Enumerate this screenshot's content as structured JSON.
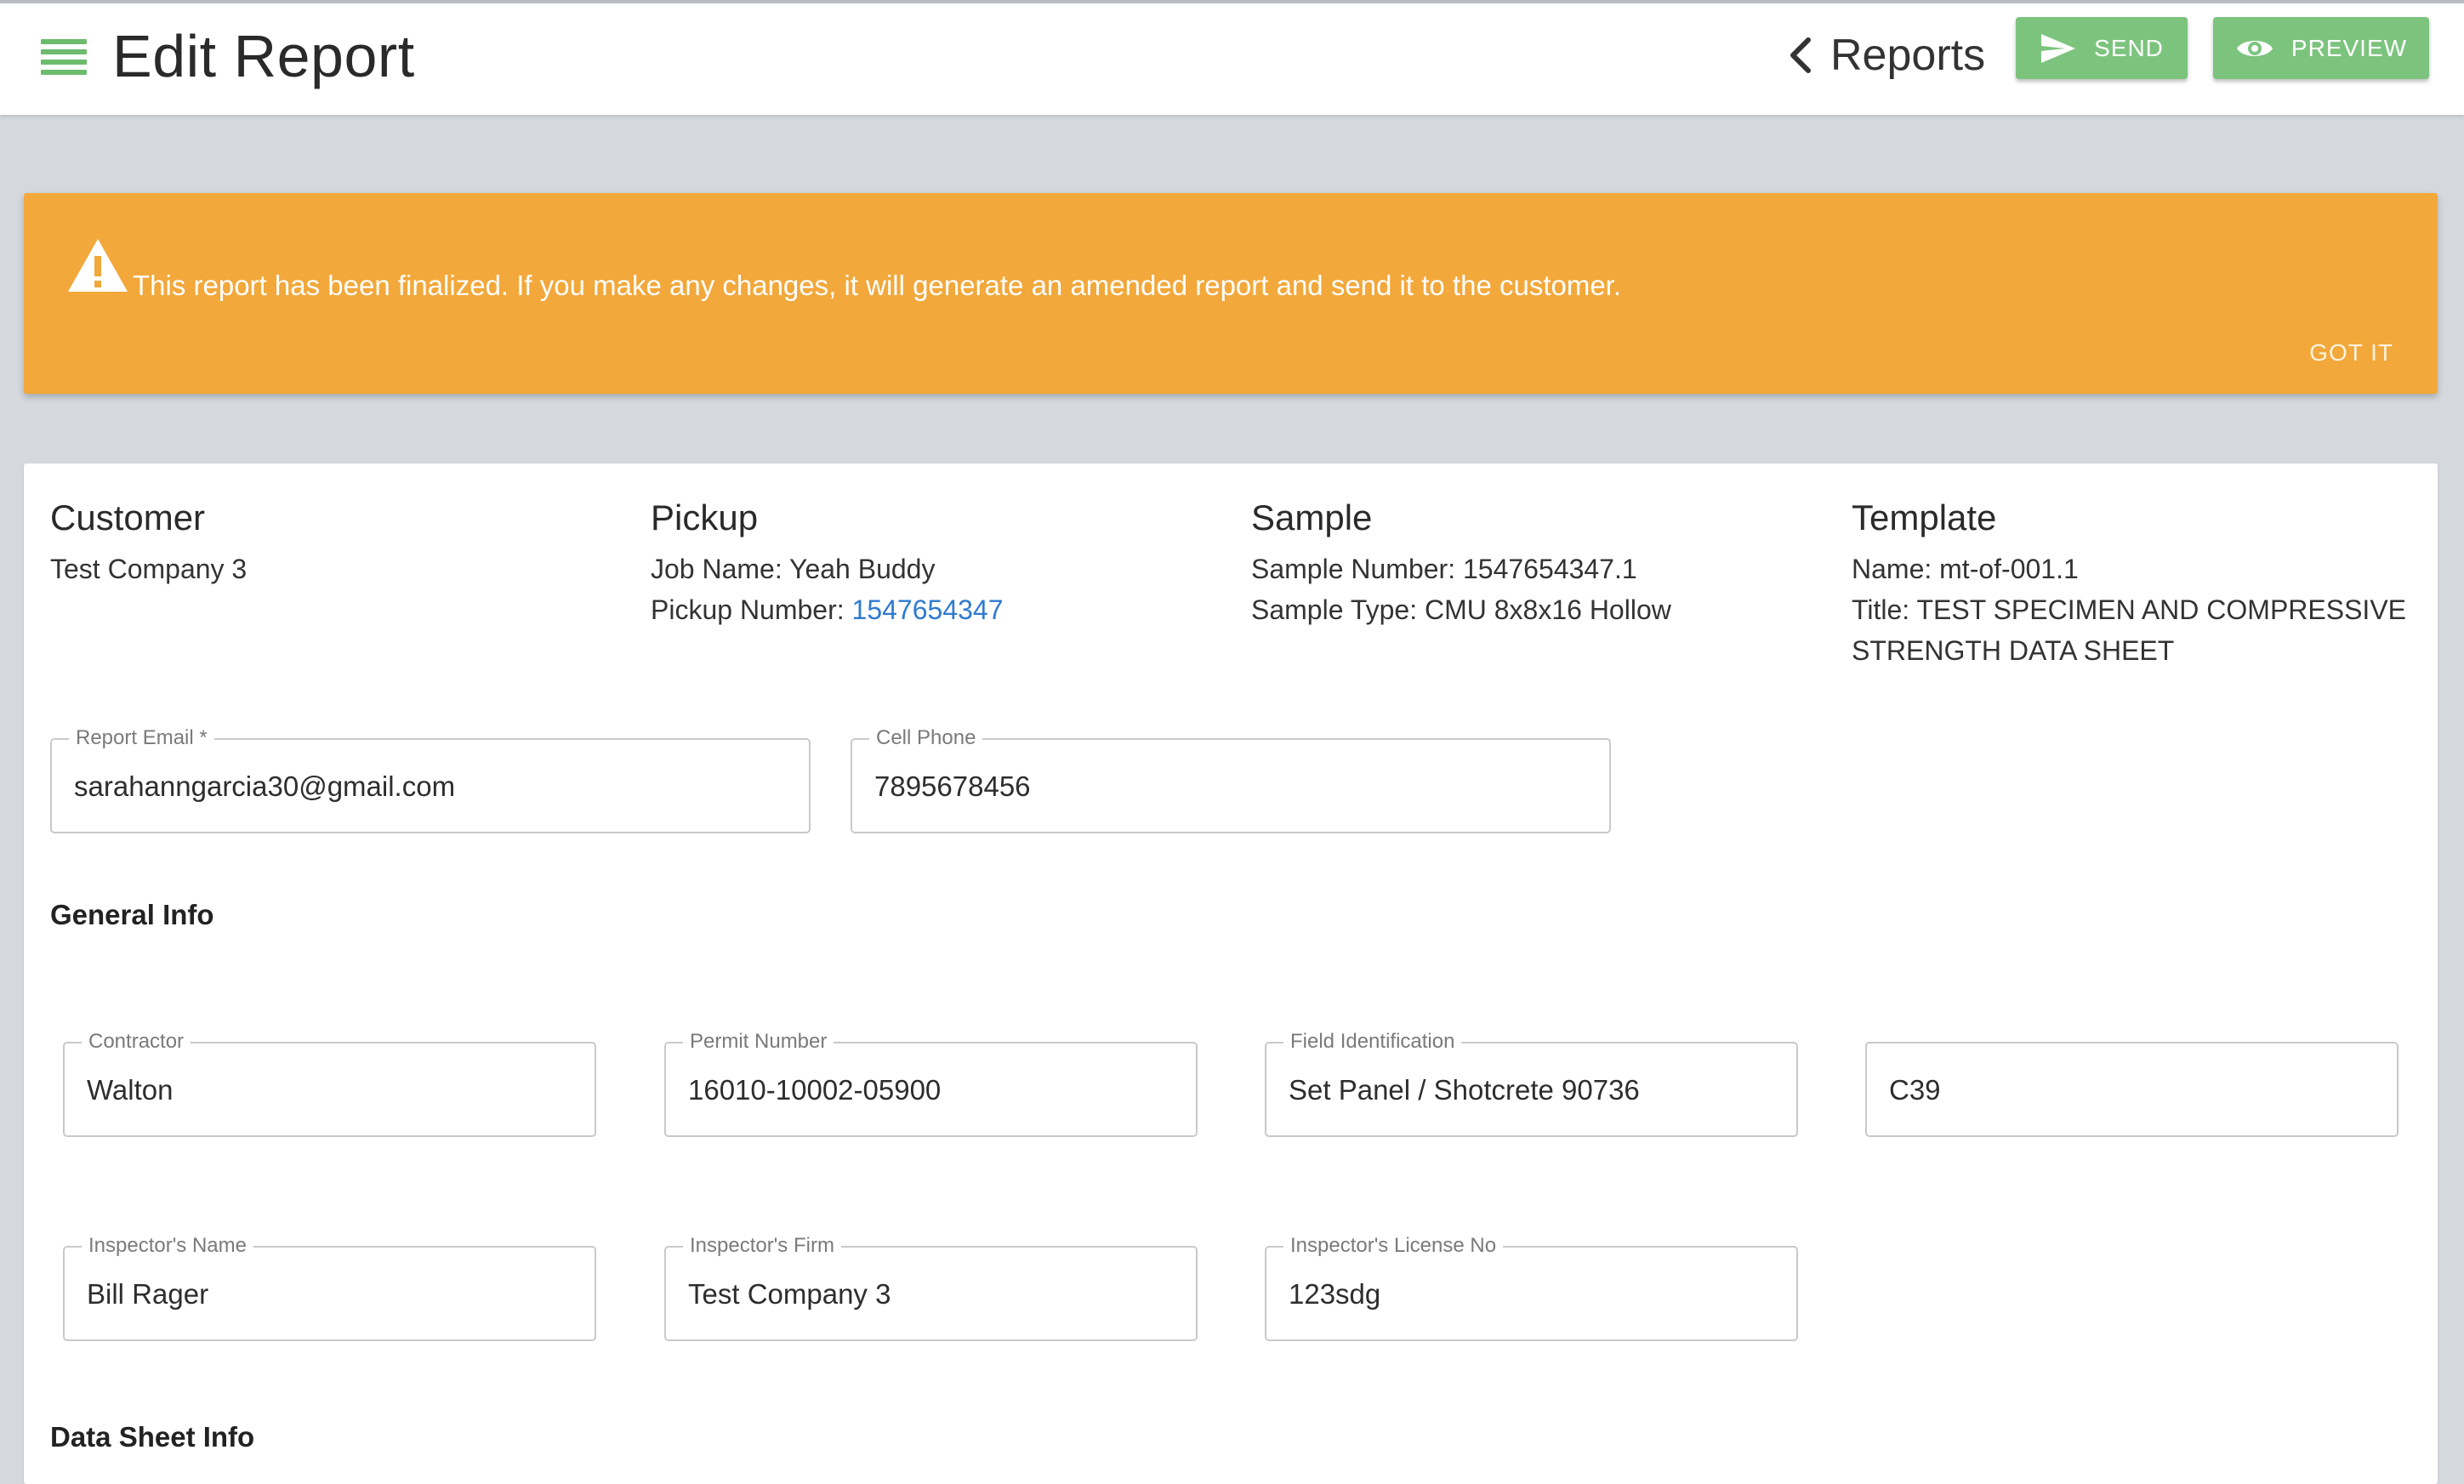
{
  "header": {
    "title": "Edit Report",
    "back_label": "Reports",
    "send_label": "SEND",
    "preview_label": "PREVIEW"
  },
  "alert": {
    "message": "This report has been finalized. If you make any changes, it will generate an amended report and send it to the customer.",
    "dismiss_label": "GOT IT"
  },
  "summary": {
    "customer": {
      "heading": "Customer",
      "name": "Test Company 3"
    },
    "pickup": {
      "heading": "Pickup",
      "job_name_label": "Job Name:",
      "job_name": "Yeah Buddy",
      "pickup_number_label": "Pickup Number:",
      "pickup_number": "1547654347"
    },
    "sample": {
      "heading": "Sample",
      "sample_number_label": "Sample Number:",
      "sample_number": "1547654347.1",
      "sample_type_label": "Sample Type:",
      "sample_type": "CMU 8x8x16 Hollow"
    },
    "template": {
      "heading": "Template",
      "name_label": "Name:",
      "name": "mt-of-001.1",
      "title_label": "Title:",
      "title_line1": "TEST SPECIMEN AND COMPRESSIVE",
      "title_line2": "STRENGTH DATA SHEET"
    }
  },
  "contact": {
    "report_email": {
      "label": "Report Email *",
      "value": "sarahanngarcia30@gmail.com"
    },
    "cell_phone": {
      "label": "Cell Phone",
      "value": "7895678456"
    }
  },
  "general_info": {
    "title": "General Info",
    "contractor": {
      "label": "Contractor",
      "value": "Walton"
    },
    "permit_number": {
      "label": "Permit Number",
      "value": "16010-10002-05900"
    },
    "field_identification": {
      "label": "Field Identification",
      "value": "Set Panel / Shotcrete 90736"
    },
    "spec": {
      "value": "C39"
    },
    "inspector_name": {
      "label": "Inspector's Name",
      "value": "Bill Rager"
    },
    "inspector_firm": {
      "label": "Inspector's Firm",
      "value": "Test Company 3"
    },
    "inspector_license": {
      "label": "Inspector's License No",
      "value": "123sdg"
    }
  },
  "data_sheet_info": {
    "title": "Data Sheet Info"
  },
  "colors": {
    "accent_green": "#7cc47e",
    "alert_orange": "#f2a83b",
    "link_blue": "#2f7ad1"
  },
  "icons": [
    "menu-icon",
    "chevron-left-icon",
    "send-icon",
    "eye-icon",
    "warning-icon"
  ]
}
